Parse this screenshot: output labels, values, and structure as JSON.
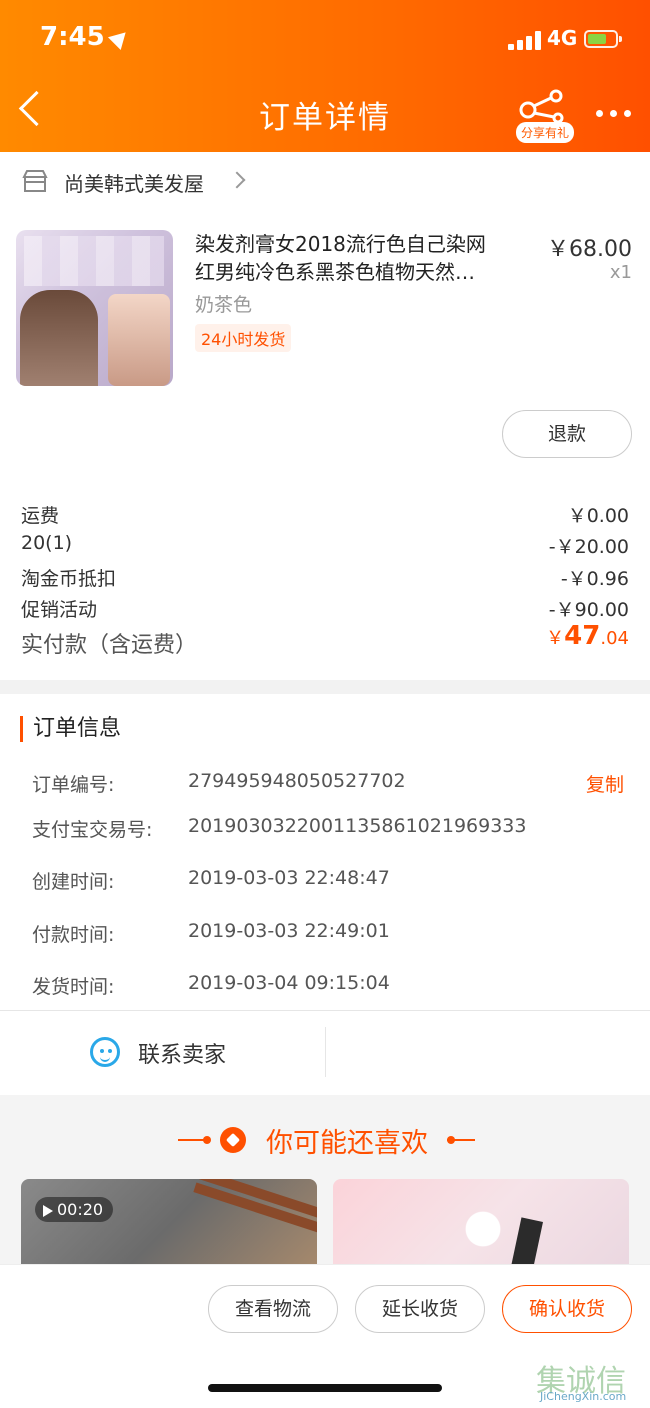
{
  "status_bar": {
    "time": "7:45",
    "network": "4G"
  },
  "nav": {
    "title": "订单详情",
    "share_badge": "分享有礼"
  },
  "shop": {
    "name": "尚美韩式美发屋"
  },
  "product": {
    "title_line1": "染发剂膏女2018流行色自己染网",
    "title_line2": "红男纯冷色系黑茶色植物天然…",
    "price": "￥68.00",
    "quantity": "x1",
    "spec": "奶茶色",
    "tag": "24小时发货",
    "refund_label": "退款"
  },
  "fees": [
    {
      "label": "运费",
      "value": "￥0.00"
    },
    {
      "label": "20(1)",
      "value": "-￥20.00"
    },
    {
      "label": "淘金币抵扣",
      "value": "-￥0.96"
    },
    {
      "label": "促销活动",
      "value": "-￥90.00"
    }
  ],
  "paid": {
    "label": "实付款（含运费）",
    "currency": "￥",
    "integer": "47",
    "decimal": ".04"
  },
  "order_info": {
    "title": "订单信息",
    "copy_label": "复制",
    "rows": [
      {
        "label": "订单编号:",
        "value": "279495948050527702"
      },
      {
        "label": "支付宝交易号:",
        "value": "2019030322001135861021969333"
      },
      {
        "label": "创建时间:",
        "value": "2019-03-03 22:48:47"
      },
      {
        "label": "付款时间:",
        "value": "2019-03-03 22:49:01"
      },
      {
        "label": "发货时间:",
        "value": "2019-03-04 09:15:04"
      }
    ]
  },
  "contact": {
    "label": "联系卖家"
  },
  "recommend": {
    "title": "你可能还喜欢",
    "video_duration": "00:20"
  },
  "bottom_actions": {
    "logistics": "查看物流",
    "extend": "延长收货",
    "confirm": "确认收货"
  },
  "watermark": {
    "zh": "集诚信",
    "en": "JiChengXin.com"
  },
  "colors": {
    "accent": "#ff5000",
    "header_start": "#ff8a00",
    "header_end": "#ff5000",
    "contact_icon": "#2aa8e8"
  }
}
